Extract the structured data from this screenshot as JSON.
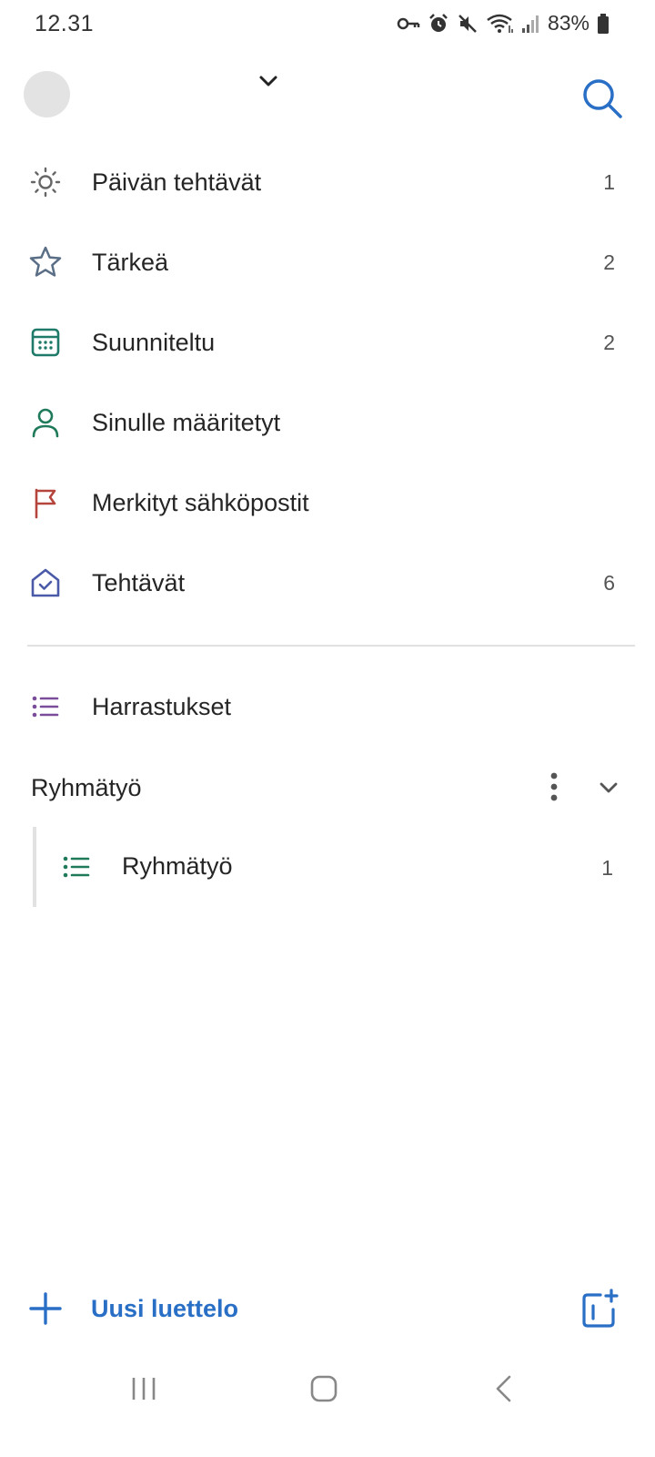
{
  "status_bar": {
    "time": "12.31",
    "battery": "83%",
    "icons": [
      "key-icon",
      "alarm-icon",
      "mute-icon",
      "wifi-icon",
      "signal-icon",
      "battery-icon"
    ]
  },
  "header": {
    "avatar": "avatar",
    "account_switcher": "chevron-down-icon",
    "search": "search-icon"
  },
  "smart_lists": [
    {
      "label": "Päivän tehtävät",
      "count": "1",
      "icon": "sun-icon",
      "color": "#6b6b6b"
    },
    {
      "label": "Tärkeä",
      "count": "2",
      "icon": "star-icon",
      "color": "#5a6e86"
    },
    {
      "label": "Suunniteltu",
      "count": "2",
      "icon": "calendar-icon",
      "color": "#1f7a6a"
    },
    {
      "label": "Sinulle määritetyt",
      "count": "",
      "icon": "person-icon",
      "color": "#1f7a5a"
    },
    {
      "label": "Merkityt sähköpostit",
      "count": "",
      "icon": "flag-icon",
      "color": "#b5443d"
    },
    {
      "label": "Tehtävät",
      "count": "6",
      "icon": "home-check-icon",
      "color": "#4a5aa8"
    }
  ],
  "lists": [
    {
      "label": "Harrastukset",
      "icon": "list-icon",
      "color": "#7a4c9a"
    }
  ],
  "group": {
    "label": "Ryhmätyö",
    "items": [
      {
        "label": "Ryhmätyö",
        "count": "1",
        "icon": "list-icon",
        "color": "#1f7a5a"
      }
    ]
  },
  "bottom": {
    "new_list_label": "Uusi luettelo",
    "accent": "#2a6fc6"
  }
}
